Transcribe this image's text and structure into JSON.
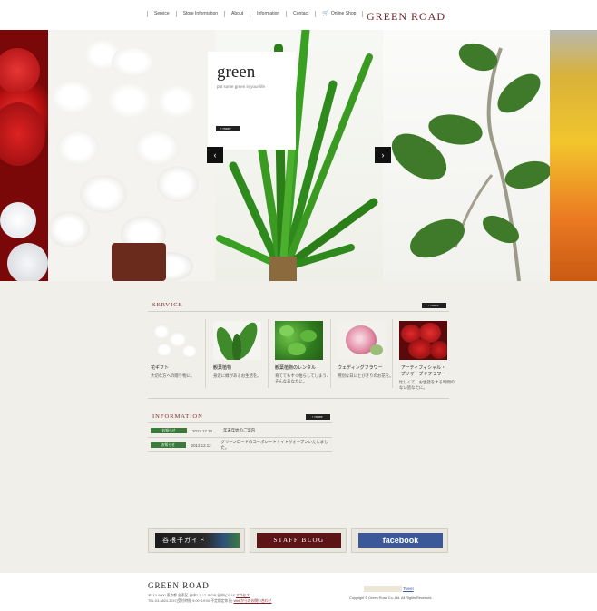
{
  "header": {
    "nav": [
      "Service",
      "Store Information",
      "About",
      "Information",
      "Contact",
      "Online Shop"
    ],
    "logo": "GREEN ROAD"
  },
  "hero": {
    "title": "green",
    "subtitle": "put some green in your life",
    "more_label": "more",
    "prev_icon": "chevron-left-icon",
    "next_icon": "chevron-right-icon"
  },
  "service": {
    "heading": "SERVICE",
    "more_label": "more",
    "items": [
      {
        "title": "花ギフト",
        "desc": [
          "大切な方への贈り物に。"
        ]
      },
      {
        "title": "観葉植物",
        "desc": [
          "身近に緑があるお生活を。"
        ]
      },
      {
        "title": "観葉植物のレンタル",
        "desc": [
          "育ててもすぐ枯らしてしまう、",
          "そんなあなたに。"
        ]
      },
      {
        "title": "ウェディングフラワー",
        "desc": [
          "特別な日にとびきりのお花を。"
        ]
      },
      {
        "title": "アーティフィシャル・",
        "title2": "プリザーブドフラワー",
        "desc": [
          "忙しくて、お世話をする時間の",
          "ない皆なたに。"
        ]
      }
    ]
  },
  "information": {
    "heading": "INFORMATION",
    "more_label": "more",
    "rows": [
      {
        "badge": "お知らせ",
        "date": "2012.12.13",
        "text": "年末年始のご案内"
      },
      {
        "badge": "お知らせ",
        "date": "2012.12.12",
        "text": "グリーンロードのコーポレートサイトがオープンいたしました。"
      }
    ]
  },
  "banners": {
    "guide": "谷根千ガイド",
    "blog": "STAFF BLOG",
    "facebook": "facebook"
  },
  "footer": {
    "logo": "GREEN ROAD",
    "address1": "〒110-0000 東京都 台東区 谷中2-7-17 JPOR 谷中ビル1F",
    "access": "アクセス",
    "address2": "TEL:03-3824-3247(受付時間 9:00~19:00 不定期定休日)",
    "web_contact": "Webからのお問い合わせ",
    "tweet": "Tweet",
    "copyright": "Copyright © Green Road Co.,Ltd. All Rights Reserved."
  },
  "colors": {
    "accent": "#7a1f22",
    "green_badge": "#3b7a3b",
    "background": "#f1efea",
    "facebook": "#3b5998"
  }
}
